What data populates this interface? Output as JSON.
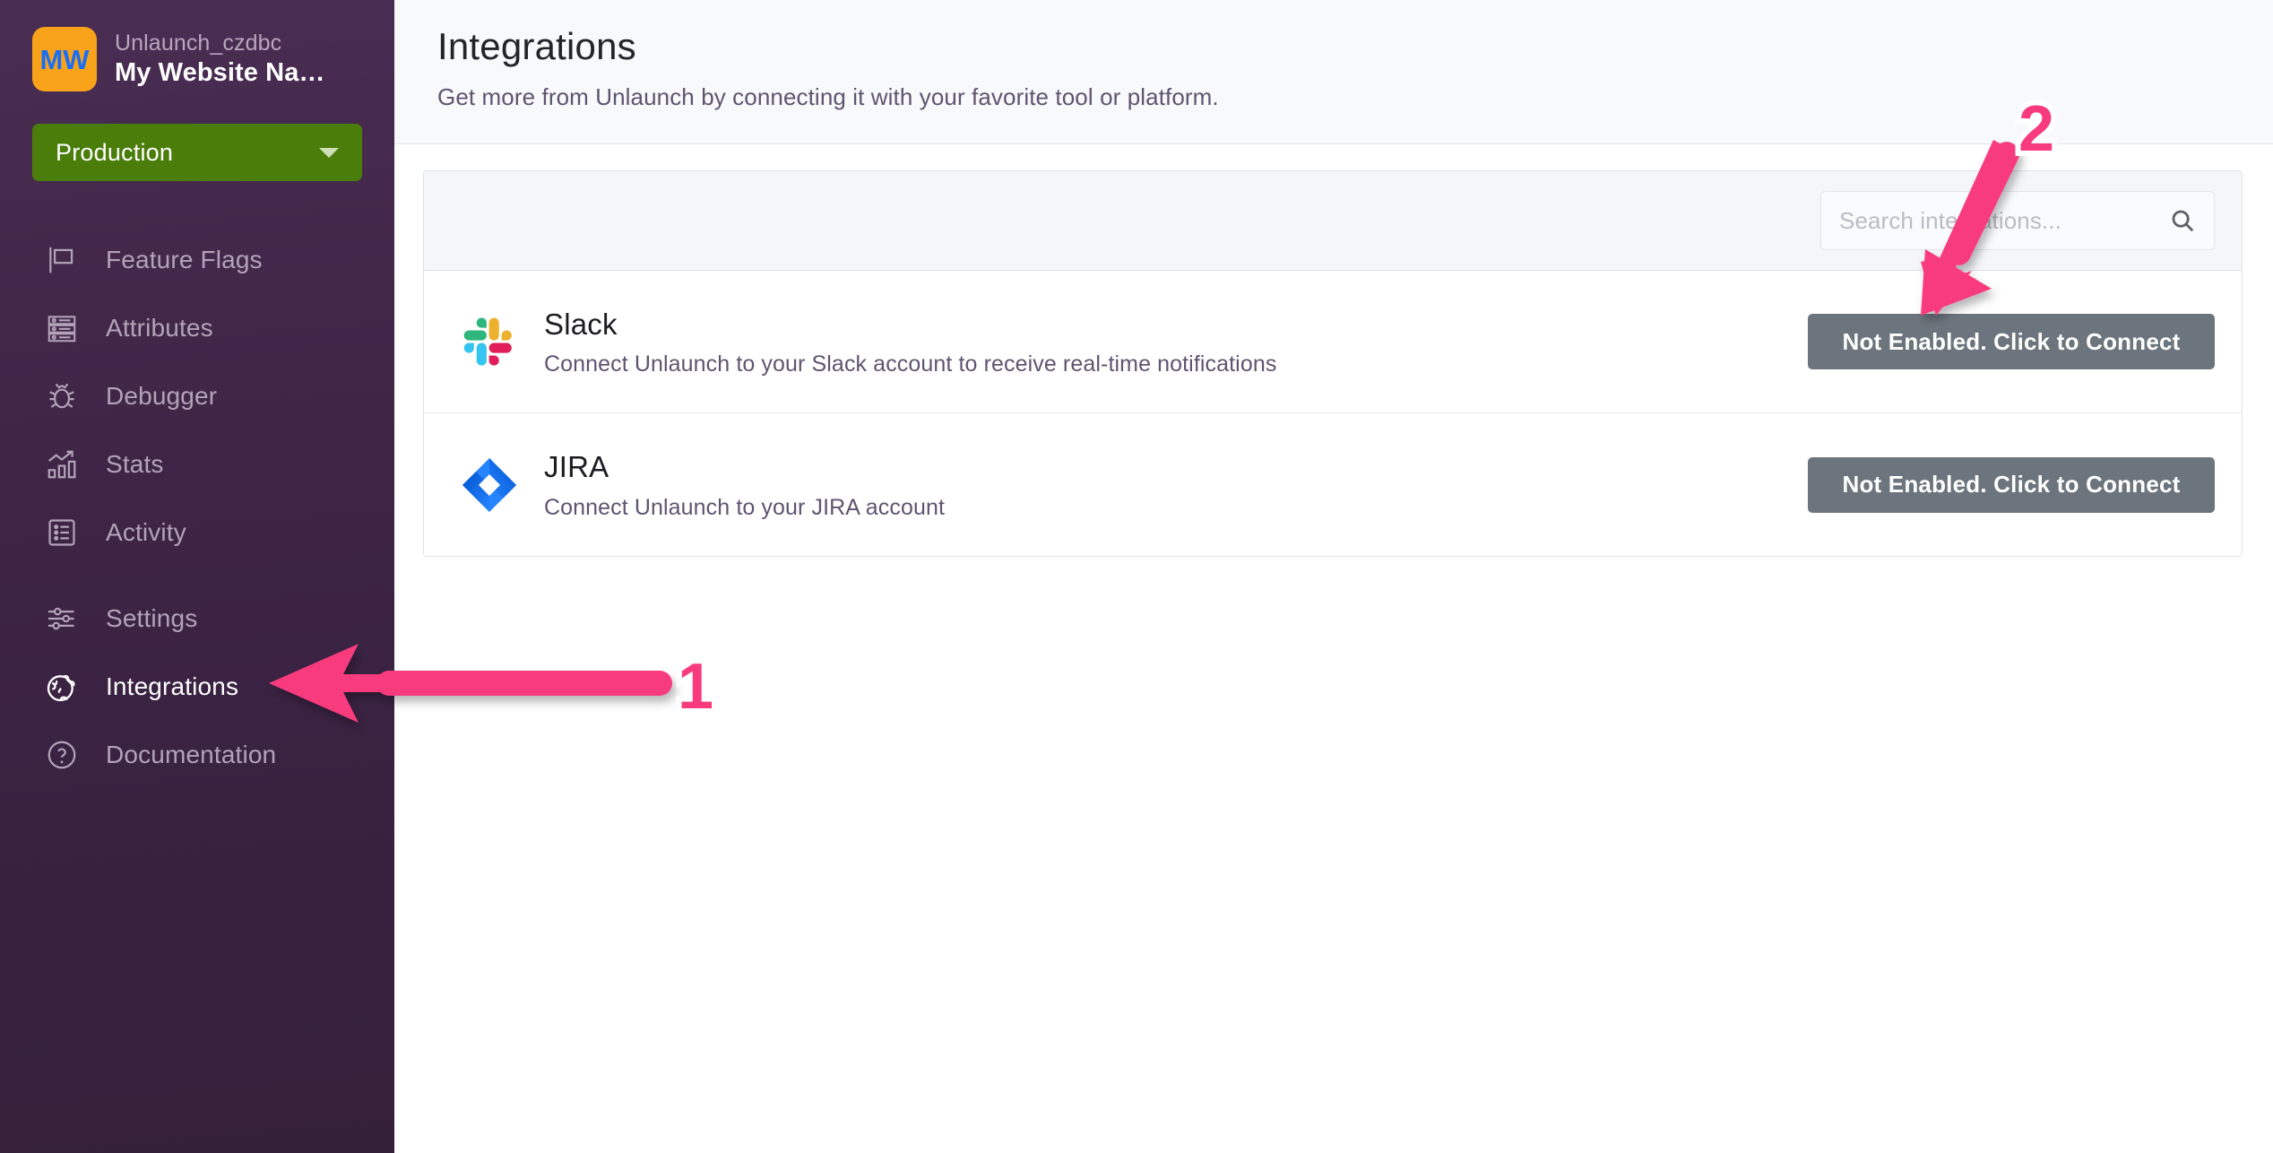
{
  "sidebar": {
    "logo_initials": "MW",
    "project_label": "Unlaunch_czdbc",
    "website_name": "My Website Na…",
    "environment": {
      "selected": "Production",
      "options": [
        "Production"
      ]
    },
    "nav_items": [
      {
        "label": "Feature Flags",
        "icon": "flag-icon",
        "active": false
      },
      {
        "label": "Attributes",
        "icon": "attributes-icon",
        "active": false
      },
      {
        "label": "Debugger",
        "icon": "bug-icon",
        "active": false
      },
      {
        "label": "Stats",
        "icon": "chart-icon",
        "active": false
      },
      {
        "label": "Activity",
        "icon": "list-icon",
        "active": false
      },
      {
        "label": "Settings",
        "icon": "sliders-icon",
        "active": false
      },
      {
        "label": "Integrations",
        "icon": "puzzle-globe-icon",
        "active": true
      },
      {
        "label": "Documentation",
        "icon": "question-circle-icon",
        "active": false
      }
    ]
  },
  "header": {
    "title": "Integrations",
    "subtitle": "Get more from Unlaunch by connecting it with your favorite tool or platform."
  },
  "search": {
    "placeholder": "Search integrations...",
    "value": "",
    "icon": "search-icon"
  },
  "integrations": [
    {
      "name": "Slack",
      "description": "Connect Unlaunch to your Slack account to receive real-time notifications",
      "logo": "slack-logo",
      "button_label": "Not Enabled. Click to Connect",
      "status": "not-enabled"
    },
    {
      "name": "JIRA",
      "description": "Connect Unlaunch to your JIRA account",
      "logo": "jira-logo",
      "button_label": "Not Enabled. Click to Connect",
      "status": "not-enabled"
    }
  ],
  "annotations": [
    {
      "number": "1",
      "points_to": "sidebar-item-integrations",
      "direction": "left"
    },
    {
      "number": "2",
      "points_to": "slack-connect-button",
      "direction": "down-left"
    }
  ],
  "colors": {
    "sidebar_bg": "#3a2242",
    "env_green": "#4b7d0b",
    "logo_orange": "#f9a31a",
    "logo_text_blue": "#1a6ef5",
    "button_gray": "#6c757d",
    "annotation_pink": "#f23a7a",
    "accent_text": "#5f5470"
  }
}
